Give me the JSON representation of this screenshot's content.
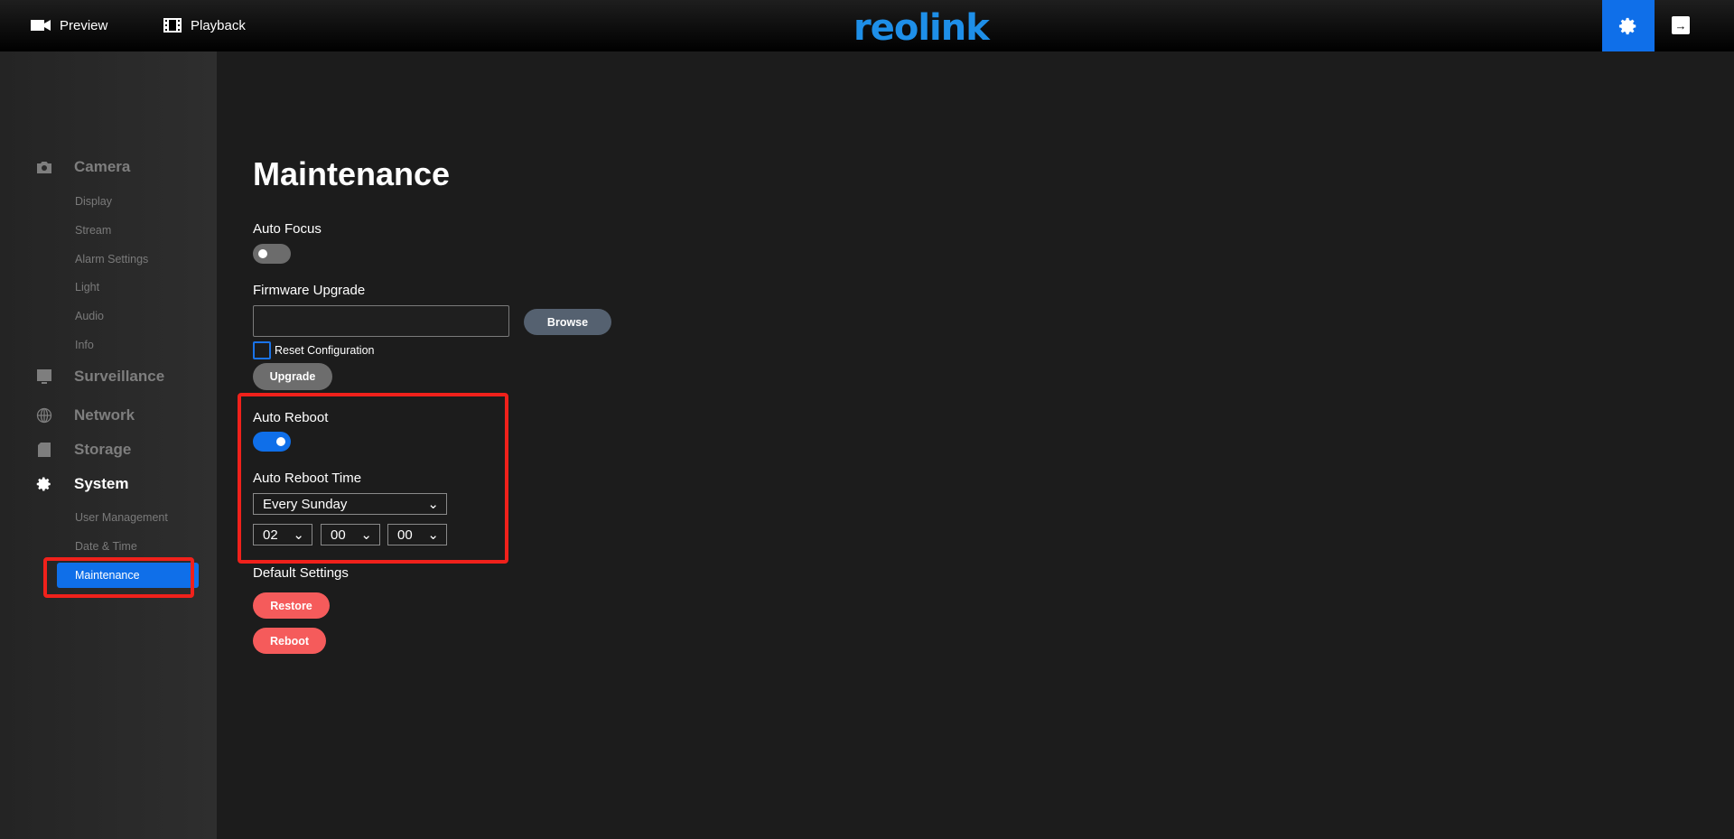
{
  "header": {
    "preview": "Preview",
    "playback": "Playback",
    "logo": "reolink",
    "accent": "#0f6fe9"
  },
  "sidebar": {
    "camera": {
      "label": "Camera",
      "items": [
        "Display",
        "Stream",
        "Alarm Settings",
        "Light",
        "Audio",
        "Info"
      ]
    },
    "surveillance": "Surveillance",
    "network": "Network",
    "storage": "Storage",
    "system": {
      "label": "System",
      "items": [
        "User Management",
        "Date & Time",
        "Maintenance"
      ]
    }
  },
  "main": {
    "title": "Maintenance",
    "auto_focus": {
      "label": "Auto Focus",
      "on": false
    },
    "firmware": {
      "label": "Firmware Upgrade",
      "file_value": "",
      "browse": "Browse",
      "reset_config": "Reset Configuration",
      "reset_checked": false,
      "upgrade": "Upgrade"
    },
    "auto_reboot": {
      "label": "Auto Reboot",
      "on": true,
      "time_label": "Auto Reboot Time",
      "day": "Every Sunday",
      "hour": "02",
      "minute": "00",
      "second": "00"
    },
    "default_settings": {
      "label": "Default Settings",
      "restore": "Restore",
      "reboot": "Reboot"
    }
  }
}
